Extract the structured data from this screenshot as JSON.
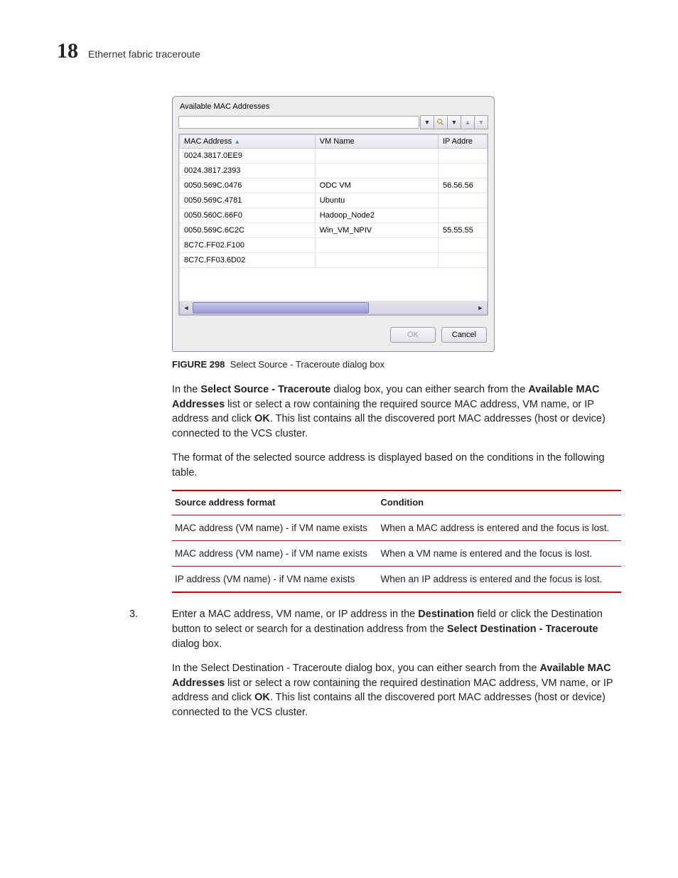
{
  "page_number": "18",
  "section_title": "Ethernet fabric traceroute",
  "dialog": {
    "title": "Available MAC Addresses",
    "columns": [
      "MAC Address",
      "VM Name",
      "IP Addre"
    ],
    "rows": [
      {
        "mac": "0024.3817.0EE9",
        "vm": "",
        "ip": ""
      },
      {
        "mac": "0024.3817.2393",
        "vm": "",
        "ip": ""
      },
      {
        "mac": "0050.569C.0476",
        "vm": "ODC VM",
        "ip": "56.56.56"
      },
      {
        "mac": "0050.569C.4781",
        "vm": "Ubuntu",
        "ip": ""
      },
      {
        "mac": "0050.560C.66F0",
        "vm": "Hadoop_Node2",
        "ip": ""
      },
      {
        "mac": "0050.569C.6C2C",
        "vm": "Win_VM_NPIV",
        "ip": "55.55.55"
      },
      {
        "mac": "8C7C.FF02.F100",
        "vm": "",
        "ip": ""
      },
      {
        "mac": "8C7C.FF03.6D02",
        "vm": "",
        "ip": ""
      }
    ],
    "ok": "OK",
    "cancel": "Cancel"
  },
  "figure_number": "FIGURE 298",
  "figure_caption": "Select Source - Traceroute dialog box",
  "para1_a": "In the ",
  "para1_b": "Select Source - Traceroute",
  "para1_c": " dialog box, you can either search from the ",
  "para1_d": "Available MAC Addresses",
  "para1_e": " list or select a row containing the required source MAC address, VM name, or IP address and click ",
  "para1_f": "OK",
  "para1_g": ". This list contains all the discovered port MAC addresses (host or device) connected to the VCS cluster.",
  "para2": "The format of the selected source address is displayed based on the conditions in the following table.",
  "cond_headers": [
    "Source address format",
    "Condition"
  ],
  "cond_rows": [
    {
      "fmt": "MAC address (VM name) - if VM name exists",
      "cond": "When a MAC address is entered and the focus is lost."
    },
    {
      "fmt": "MAC address (VM name) - if VM name exists",
      "cond": "When a VM name is entered and the focus is lost."
    },
    {
      "fmt": "IP address (VM name) - if VM name exists",
      "cond": "When an IP address is entered and the focus is lost."
    }
  ],
  "step3_num": "3.",
  "step3_a": "Enter a MAC address, VM name, or IP address in the ",
  "step3_b": "Destination",
  "step3_c": " field or click the Destination button to select or search for a destination address from the ",
  "step3_d": "Select Destination - Traceroute",
  "step3_e": " dialog box.",
  "step3_p2_a": "In the Select Destination - Traceroute dialog box, you can either search from the ",
  "step3_p2_b": "Available MAC Addresses",
  "step3_p2_c": " list or select a row containing the required destination MAC address, VM name, or IP address and click ",
  "step3_p2_d": "OK",
  "step3_p2_e": ". This list contains all the discovered port MAC addresses (host or device) connected to the VCS cluster."
}
